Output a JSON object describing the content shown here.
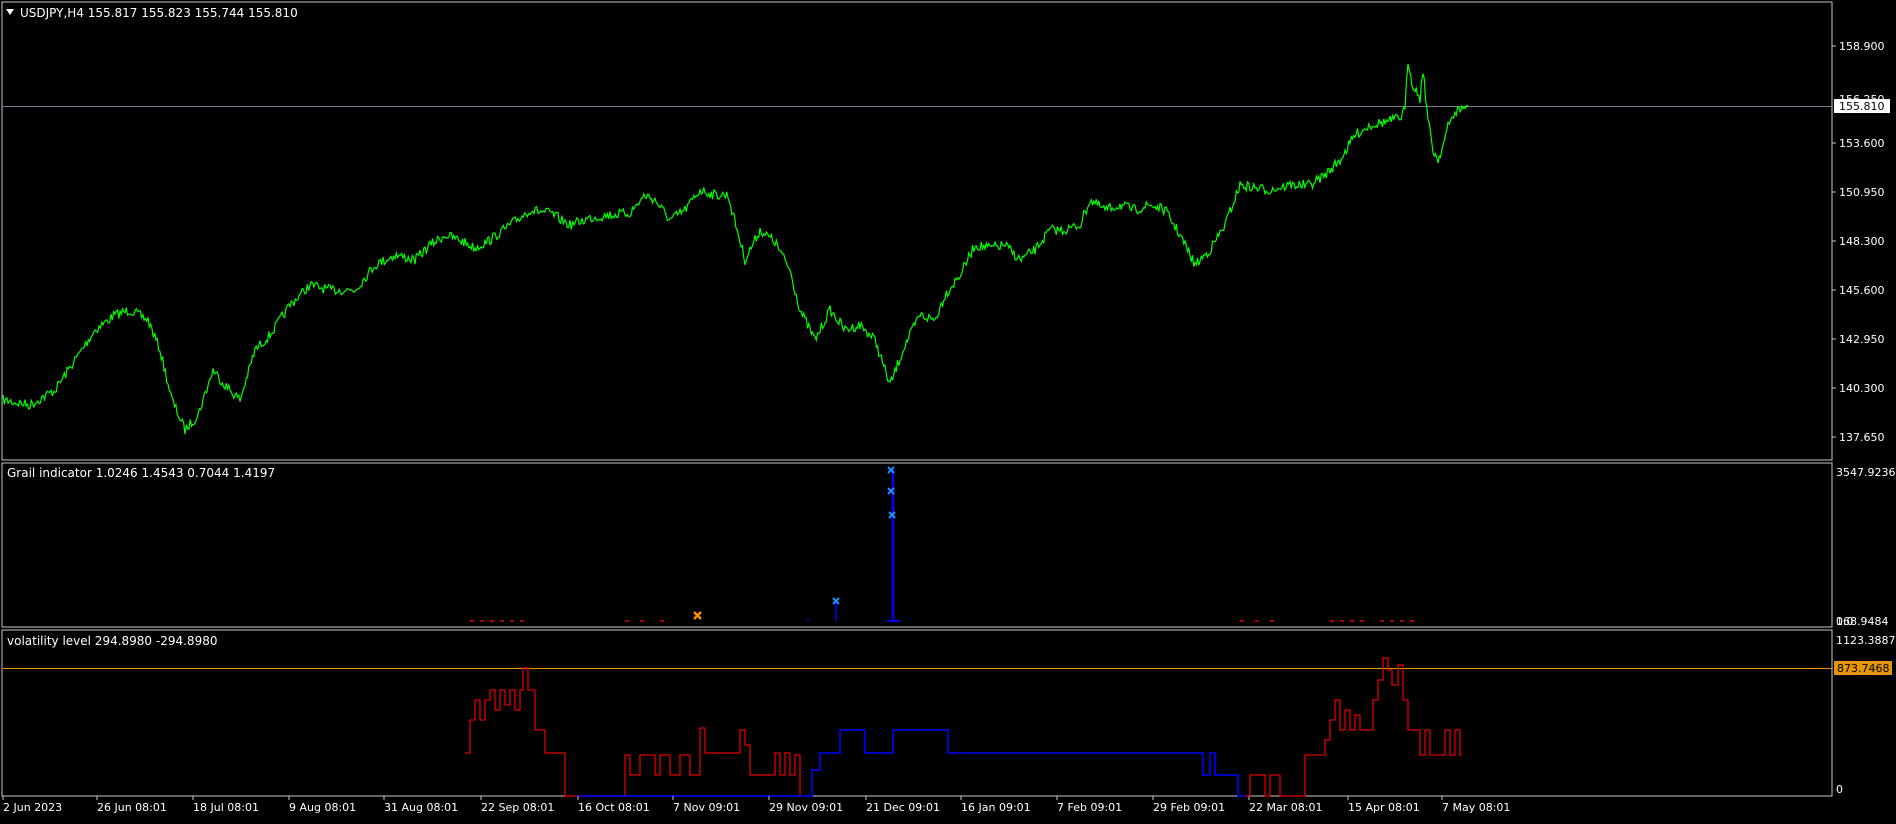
{
  "colors": {
    "background": "#000000",
    "frame": "#c8c8c8",
    "price_line": "#00ff00",
    "bid_line": "#6f8596",
    "signal_blue": "#0000ff",
    "marker_blue": "#1e90ff",
    "marker_orange": "#ff8c00",
    "volatility_red": "#dd0000",
    "level_orange": "#e69500"
  },
  "main_panel": {
    "header": "USDJPY,H4  155.817 155.823 155.744 155.810",
    "current_price_label": "155.810",
    "hidden_tick_label": "156.250",
    "price_scale": [
      "158.900",
      "153.600",
      "150.950",
      "148.300",
      "145.600",
      "142.950",
      "140.300",
      "137.650"
    ]
  },
  "grail_panel": {
    "header": "Grail indicator 1.0246 1.4543 0.7044 1.4197",
    "scale_top": "3547.9236",
    "scale_bottom": "168.9484",
    "scale_bottom_overlap": "0.0"
  },
  "volatility_panel": {
    "header": "volatility level 294.8980 -294.8980",
    "scale_top": "1123.3887",
    "level_label": "873.7468",
    "scale_bottom": "0"
  },
  "time_axis": {
    "labels": [
      "2 Jun 2023",
      "26 Jun 08:01",
      "18 Jul 08:01",
      "9 Aug 08:01",
      "31 Aug 08:01",
      "22 Sep 08:01",
      "16 Oct 08:01",
      "7 Nov 09:01",
      "29 Nov 09:01",
      "21 Dec 09:01",
      "16 Jan 09:01",
      "7 Feb 09:01",
      "29 Feb 09:01",
      "22 Mar 08:01",
      "15 Apr 08:01",
      "7 May 08:01"
    ]
  },
  "chart_data": [
    {
      "type": "line",
      "title": "USDJPY,H4  155.817 155.823 155.744 155.810",
      "series": [
        {
          "name": "USDJPY",
          "x": [
            "2 Jun 2023",
            "26 Jun 08:01",
            "18 Jul 08:01",
            "9 Aug 08:01",
            "31 Aug 08:01",
            "22 Sep 08:01",
            "16 Oct 08:01",
            "7 Nov 09:01",
            "29 Nov 09:01",
            "21 Dec 09:01",
            "16 Jan 09:01",
            "7 Feb 09:01",
            "29 Feb 09:01",
            "22 Mar 08:01",
            "15 Apr 08:01",
            "7 May 08:01"
          ],
          "values": [
            139.2,
            144.5,
            141.0,
            145.3,
            146.2,
            149.2,
            149.4,
            151.7,
            146.4,
            143.3,
            147.8,
            150.1,
            149.8,
            151.3,
            154.6,
            155.8
          ]
        }
      ],
      "ylim": [
        137.65,
        160.0
      ],
      "grid": false
    },
    {
      "type": "bar",
      "title": "Grail indicator 1.0246 1.4543 0.7044 1.4197",
      "markers": [
        {
          "x": "7 Nov 09:01",
          "y": 300,
          "color": "orange"
        },
        {
          "x": "29 Nov 09:01",
          "y": 740,
          "color": "blue"
        },
        {
          "x": "21 Dec 09:01",
          "y": 2700,
          "color": "blue"
        },
        {
          "x": "21 Dec 09:01",
          "y": 3100,
          "color": "blue"
        },
        {
          "x": "21 Dec 09:01",
          "y": 3547.9236,
          "color": "blue"
        }
      ],
      "spike": {
        "x": "21 Dec 09:01",
        "value": 3547.9236
      },
      "ylim": [
        0,
        3547.9236
      ]
    },
    {
      "type": "line",
      "title": "volatility level 294.8980 -294.8980",
      "level": 873.7468,
      "series": [
        {
          "name": "red",
          "x": [
            "22 Sep 08:01",
            "29 Sep",
            "6 Oct",
            "16 Oct 08:01",
            "20 Oct",
            "26 Oct",
            "7 Nov 09:01",
            "15 Nov",
            "23 Nov",
            "29 Nov 09:01",
            "22 Mar 08:01",
            "1 Apr",
            "8 Apr",
            "15 Apr 08:01",
            "20 Apr",
            "25 Apr",
            "7 May 08:01"
          ],
          "values": [
            220,
            560,
            700,
            0,
            190,
            260,
            330,
            180,
            110,
            0,
            120,
            330,
            600,
            1123.3887,
            500,
            370,
            320
          ]
        },
        {
          "name": "blue",
          "x": [
            "29 Nov 09:01",
            "14 Dec",
            "21 Dec 09:01",
            "7 Jan",
            "16 Jan 09:01",
            "7 Feb 09:01",
            "29 Feb 09:01",
            "10 Mar",
            "22 Mar 08:01"
          ],
          "values": [
            230,
            350,
            370,
            220,
            220,
            220,
            220,
            100,
            0
          ]
        }
      ],
      "ylim": [
        0,
        1123.3887
      ]
    }
  ]
}
